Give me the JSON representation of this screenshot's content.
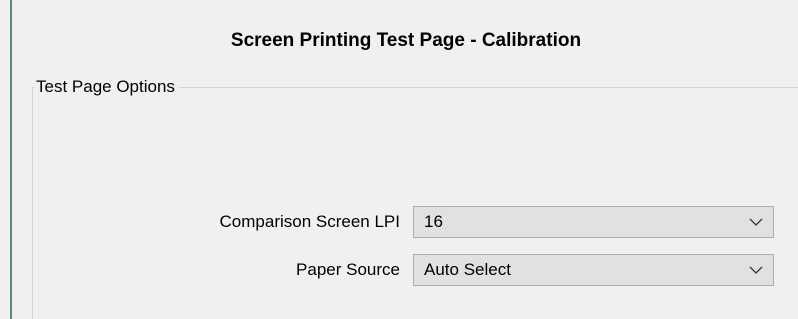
{
  "dialog": {
    "title": "Screen Printing Test Page - Calibration"
  },
  "test_page_options": {
    "legend": "Test Page Options",
    "comparison_screen_lpi": {
      "label": "Comparison Screen LPI",
      "value": "16"
    },
    "paper_source": {
      "label": "Paper Source",
      "value": "Auto Select"
    }
  },
  "icons": {
    "dropdown": "chevron-down-icon"
  },
  "colors": {
    "background": "#f0f0f0",
    "combo_background": "#e1e1e1",
    "combo_border": "#adadad",
    "window_edge": "#5a8a86"
  }
}
